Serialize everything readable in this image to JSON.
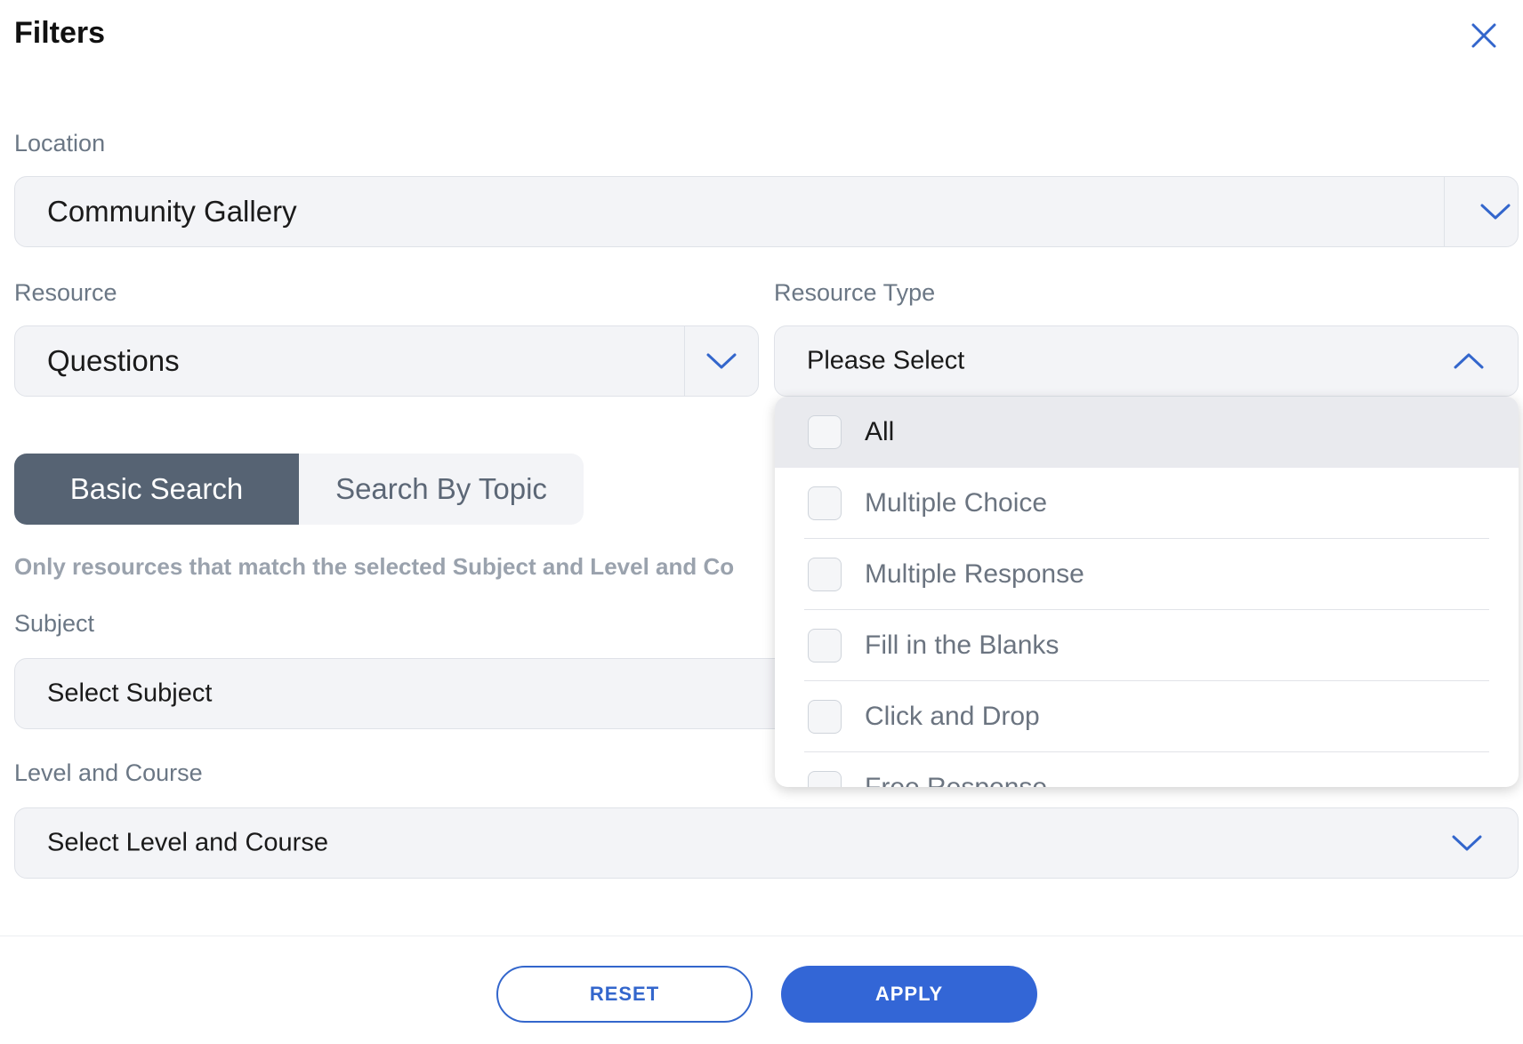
{
  "header": {
    "title": "Filters",
    "close_icon": "close-icon"
  },
  "location": {
    "label": "Location",
    "value": "Community Gallery"
  },
  "resource": {
    "label": "Resource",
    "value": "Questions"
  },
  "resource_type": {
    "label": "Resource Type",
    "value": "Please Select",
    "options": [
      "All",
      "Multiple Choice",
      "Multiple Response",
      "Fill in the Blanks",
      "Click and Drop",
      "Free Response"
    ]
  },
  "search_mode": {
    "basic": "Basic Search",
    "topic": "Search By Topic",
    "active": "Basic Search"
  },
  "hint": "Only resources that match the selected Subject and Level and Co",
  "subject": {
    "label": "Subject",
    "placeholder": "Select Subject"
  },
  "level_course": {
    "label": "Level and Course",
    "placeholder": "Select Level and Course"
  },
  "footer": {
    "reset": "RESET",
    "apply": "APPLY"
  },
  "colors": {
    "accent": "#3366d6",
    "toggle_active": "#566373",
    "field_bg": "#f3f4f7",
    "label": "#6b7785"
  }
}
